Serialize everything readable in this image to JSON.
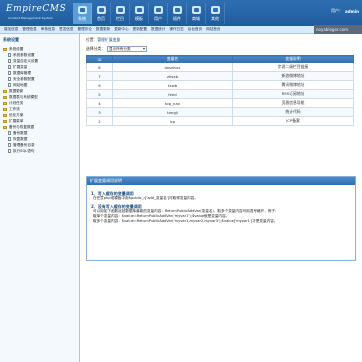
{
  "header": {
    "logo_text": "EmpireCMS",
    "logo_sub": "Content Management System",
    "nav": [
      {
        "label": "系统",
        "active": true,
        "icon": "gear-icon"
      },
      {
        "label": "首页",
        "active": false,
        "icon": "home-icon"
      },
      {
        "label": "栏目",
        "active": false,
        "icon": "column-icon"
      },
      {
        "label": "模板",
        "active": false,
        "icon": "template-icon"
      },
      {
        "label": "用户",
        "active": false,
        "icon": "user-icon"
      },
      {
        "label": "插件",
        "active": false,
        "icon": "plugin-icon"
      },
      {
        "label": "商城",
        "active": false,
        "icon": "shop-icon"
      },
      {
        "label": "其他",
        "active": false,
        "icon": "other-icon"
      }
    ],
    "user_label": "用户：",
    "user_name": "admin"
  },
  "subnav": {
    "items": [
      "增加信息",
      "管理信息",
      "审核信息",
      "签发信息",
      "管理评论",
      "数据更新",
      "更新中心",
      "更新配置",
      "数据统计",
      "操作日志",
      "后台首页",
      "网站首页"
    ]
  },
  "watermark_text": "noyabloger.com",
  "sidebar": {
    "title": "系统设置",
    "items": [
      {
        "label": "系统设置",
        "level": 0,
        "type": "folder"
      },
      {
        "label": "系统参数设置",
        "level": 1,
        "type": "file"
      },
      {
        "label": "变量自定义设置",
        "level": 1,
        "type": "file"
      },
      {
        "label": "扩展变量",
        "level": 1,
        "type": "file"
      },
      {
        "label": "数据库管理",
        "level": 1,
        "type": "file"
      },
      {
        "label": "安全参数配置",
        "level": 1,
        "type": "file"
      },
      {
        "label": "网站地图",
        "level": 1,
        "type": "file"
      },
      {
        "label": "数据更新",
        "level": 0,
        "type": "folder"
      },
      {
        "label": "数据表与系统模型",
        "level": 0,
        "type": "folder"
      },
      {
        "label": "计划任务",
        "level": 0,
        "type": "folder"
      },
      {
        "label": "工作流",
        "level": 0,
        "type": "folder"
      },
      {
        "label": "优化方案",
        "level": 0,
        "type": "folder"
      },
      {
        "label": "扩展菜单",
        "level": 0,
        "type": "folder"
      },
      {
        "label": "备份与恢复数据",
        "level": 0,
        "type": "folder"
      },
      {
        "label": "备份数据",
        "level": 1,
        "type": "file"
      },
      {
        "label": "恢复数据",
        "level": 1,
        "type": "file"
      },
      {
        "label": "管理备份目录",
        "level": 1,
        "type": "file"
      },
      {
        "label": "执行SQL语句",
        "level": 1,
        "type": "file"
      }
    ]
  },
  "main": {
    "crumb_prefix": "位置：",
    "crumb_link": "管理扩展变量",
    "filter_label": "选择分类：",
    "filter_value": "显示所有分类",
    "table": {
      "headers": [
        "ID",
        "变量名",
        "变量说明"
      ],
      "rows": [
        {
          "id": "8",
          "name": "dxsdhxx",
          "desc": "步说二级栏目链接"
        },
        {
          "id": "7",
          "name": "zhsxb",
          "desc": "新浪微博地址"
        },
        {
          "id": "6",
          "name": "txwb",
          "desc": "腾讯微博地址"
        },
        {
          "id": "5",
          "name": "feed",
          "desc": "RSS订阅地址"
        },
        {
          "id": "4",
          "name": "top_nav",
          "desc": "页眉信息导航"
        },
        {
          "id": "3",
          "name": "tongji",
          "desc": "统计代码"
        },
        {
          "id": "2",
          "name": "icp",
          "desc": "ICP备案"
        }
      ]
    }
  },
  "help": {
    "title": "扩展变量调用说明",
    "sections": [
      {
        "heading": "1、写入缓存的变量调用",
        "lines": [
          "在任意php或模板中用$public_r['add_变量名']可取得变量内容。"
        ]
      },
      {
        "heading": "2、没有写入缓存的变量调用",
        "lines": [
          "可以用如下函数返回数据库最新的变量内容：ReturnPublicAddVar(变量名)，取多个变量内容可用逗号格开，例子：",
          "取单个变量内容：$value=ReturnPublicAddVar('myvar1');$value就是变量内容。",
          "取多个变量内容：$value=ReturnPublicAddVar('myvar1,myvar2,myvar3');$value['myvar1']才是变量内容。"
        ]
      }
    ]
  }
}
